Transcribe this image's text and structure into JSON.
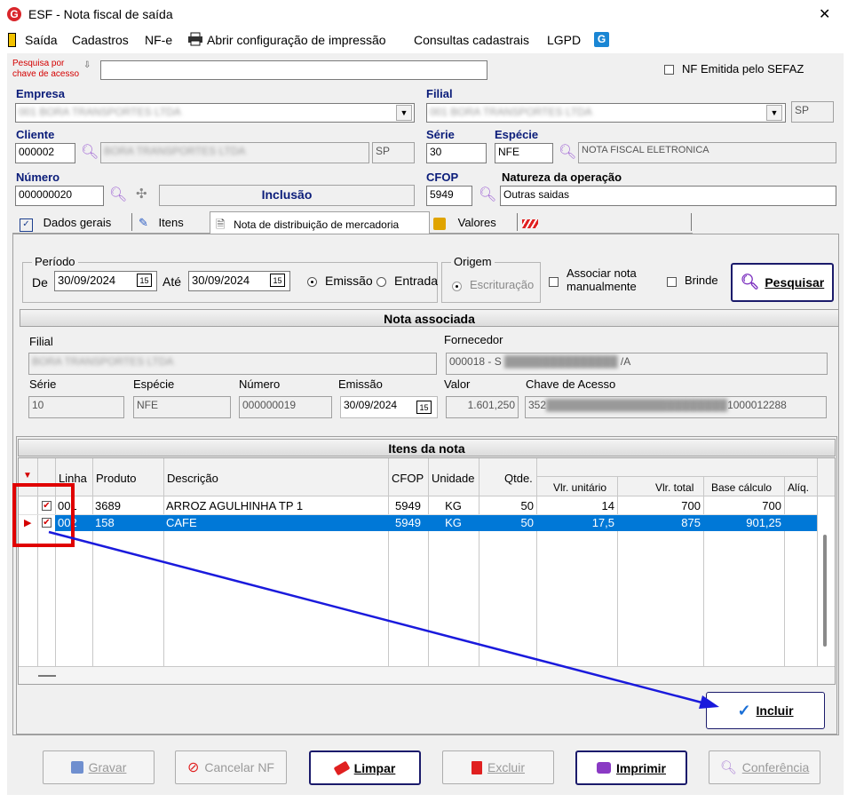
{
  "window": {
    "title": "ESF - Nota fiscal de saída",
    "close_glyph": "✕"
  },
  "menu": [
    "Saída",
    "Cadastros",
    "NF-e",
    "Abrir configuração de impressão",
    "Consultas cadastrais",
    "LGPD"
  ],
  "search": {
    "label": "Pesquisa por chave de acesso",
    "value": ""
  },
  "sefaz": {
    "label": "NF Emitida pelo SEFAZ",
    "checked": false
  },
  "empresa": {
    "label": "Empresa",
    "value": "001 BORA TRANSPORTES LTDA"
  },
  "filial": {
    "label": "Filial",
    "value": "001 BORA TRANSPORTES LTDA",
    "uf": "SP"
  },
  "cliente": {
    "label": "Cliente",
    "code": "000002",
    "name": "BORA TRANSPORTES LTDA",
    "uf": "SP"
  },
  "serie": {
    "label": "Série",
    "value": "30"
  },
  "especie": {
    "label": "Espécie",
    "code": "NFE",
    "desc": "NOTA FISCAL ELETRONICA"
  },
  "numero": {
    "label": "Número",
    "value": "000000020",
    "status": "Inclusão"
  },
  "cfop": {
    "label": "CFOP",
    "value": "5949"
  },
  "natureza": {
    "label": "Natureza da operação",
    "value": "Outras saidas"
  },
  "tabs": [
    "Dados gerais",
    "Itens",
    "Nota de distribuição de mercadoria",
    "Valores"
  ],
  "periodo": {
    "title": "Período",
    "de_label": "De",
    "de_value": "30/09/2024",
    "ate_label": "Até",
    "ate_value": "30/09/2024",
    "emissao_label": "Emissão",
    "entrada_label": "Entrada",
    "selected": "Emissão"
  },
  "origem": {
    "title": "Origem",
    "option": "Escrituração"
  },
  "associar": {
    "label": "Associar nota manualmente"
  },
  "brinde": {
    "label": "Brinde"
  },
  "pesquisar_label": "Pesquisar",
  "nota_associada": {
    "title": "Nota associada",
    "filial_label": "Filial",
    "filial_value": "BORA TRANSPORTES LTDA",
    "fornecedor_label": "Fornecedor",
    "fornecedor_value": "000018 - S",
    "fornecedor_suffix": "/A",
    "serie_label": "Série",
    "serie_value": "10",
    "especie_label": "Espécie",
    "especie_value": "NFE",
    "numero_label": "Número",
    "numero_value": "000000019",
    "emissao_label": "Emissão",
    "emissao_value": "30/09/2024",
    "valor_label": "Valor",
    "valor_value": "1.601,250",
    "chave_label": "Chave de Acesso",
    "chave_prefix": "352",
    "chave_suffix": "1000012288"
  },
  "itens": {
    "title": "Itens da nota",
    "columns": [
      "Linha",
      "Produto",
      "Descrição",
      "CFOP",
      "Unidade",
      "Qtde.",
      "Vlr. unitário",
      "Vlr. total",
      "Base cálculo",
      "Alíq."
    ],
    "rows": [
      {
        "linha": "001",
        "produto": "3689",
        "descricao": "ARROZ AGULHINHA TP 1",
        "cfop": "5949",
        "unidade": "KG",
        "qtde": "50",
        "vlr_unit": "14",
        "vlr_total": "700",
        "base": "700",
        "aliq": ""
      },
      {
        "linha": "002",
        "produto": "158",
        "descricao": "CAFE",
        "cfop": "5949",
        "unidade": "KG",
        "qtde": "50",
        "vlr_unit": "17,5",
        "vlr_total": "875",
        "base": "901,25",
        "aliq": ""
      }
    ]
  },
  "incluir_label": "Incluir",
  "footer": {
    "gravar": "Gravar",
    "cancelar": "Cancelar NF",
    "limpar": "Limpar",
    "excluir": "Excluir",
    "imprimir": "Imprimir",
    "conferencia": "Conferência"
  },
  "colors": {
    "accent_blue": "#0b1d7a",
    "selected_row": "#0078d7",
    "annotation_red": "#e00000",
    "annotation_arrow": "#1a1adc"
  }
}
